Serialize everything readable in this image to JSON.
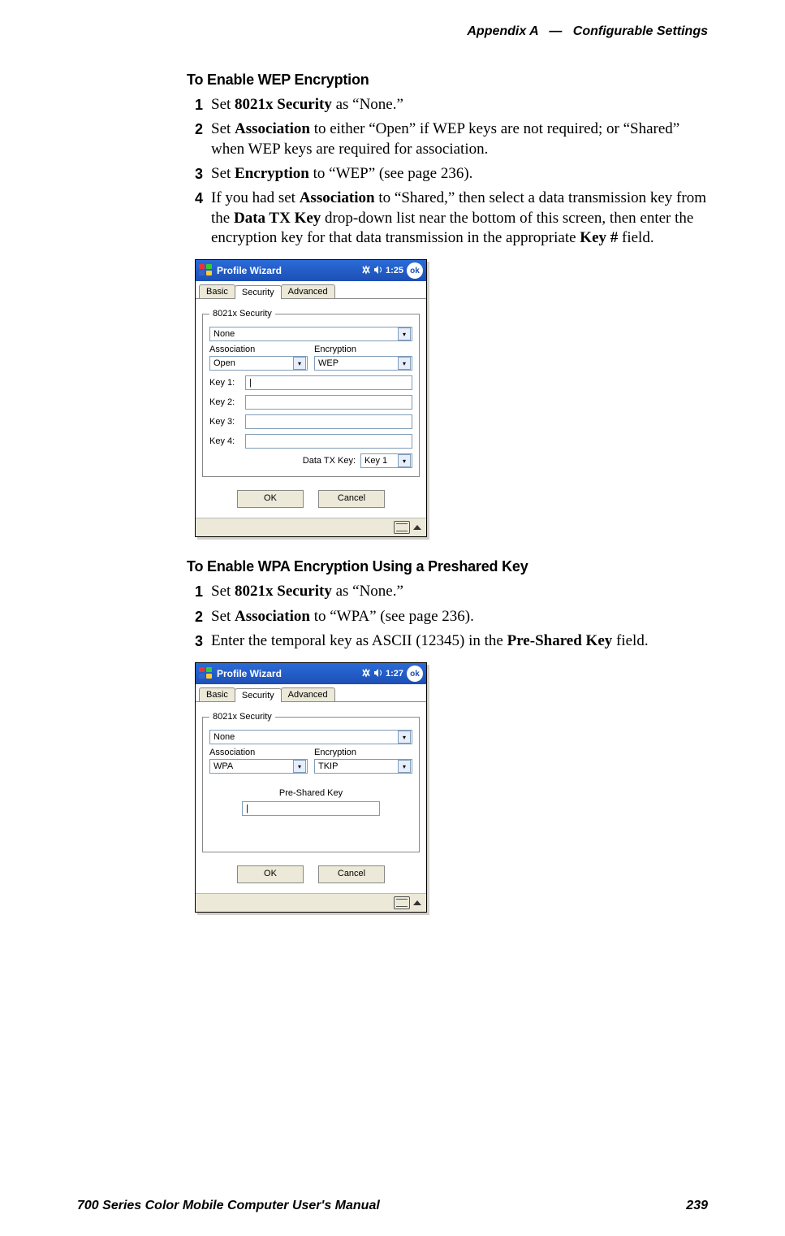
{
  "header": {
    "appendix": "Appendix A",
    "sep": "—",
    "title": "Configurable Settings"
  },
  "footer": {
    "left": "700 Series Color Mobile Computer User's Manual",
    "right": "239"
  },
  "wep": {
    "title": "To Enable WEP Encryption",
    "steps": {
      "s1": {
        "num": "1",
        "pre": "Set ",
        "b1": "8021x Security",
        "post": " as “None.”"
      },
      "s2": {
        "num": "2",
        "pre": "Set ",
        "b1": "Association",
        "post": " to either “Open” if WEP keys are not required; or “Shared” when WEP keys are required for association."
      },
      "s3": {
        "num": "3",
        "pre": "Set ",
        "b1": "Encryption",
        "post": " to “WEP” (see page 236)."
      },
      "s4": {
        "num": "4",
        "a": "If you had set ",
        "b1": "Association",
        "b": " to “Shared,” then select a data transmission key from the ",
        "b2": "Data TX Key",
        "c": " drop-down list near the bottom of this screen, then enter the encryption key for that data transmission in the appropriate ",
        "b3": "Key #",
        "d": " field."
      }
    }
  },
  "wpa": {
    "title": "To Enable WPA Encryption Using a Preshared Key",
    "steps": {
      "s1": {
        "num": "1",
        "pre": "Set ",
        "b1": "8021x Security",
        "post": " as “None.”"
      },
      "s2": {
        "num": "2",
        "pre": "Set ",
        "b1": "Association",
        "post": " to “WPA” (see page 236)."
      },
      "s3": {
        "num": "3",
        "a": "Enter the temporal key as ASCII (12345) in the ",
        "b1": "Pre-Shared Key",
        "b": " field."
      }
    }
  },
  "shot1": {
    "title": "Profile Wizard",
    "clock": "1:25",
    "ok": "ok",
    "tabs": {
      "basic": "Basic",
      "security": "Security",
      "advanced": "Advanced"
    },
    "group": "8021x Security",
    "securitySel": "None",
    "assocLabel": "Association",
    "encLabel": "Encryption",
    "assocSel": "Open",
    "encSel": "WEP",
    "key1": "Key 1:",
    "key2": "Key 2:",
    "key3": "Key 3:",
    "key4": "Key 4:",
    "dtxLabel": "Data TX Key:",
    "dtxSel": "Key 1",
    "okbtn": "OK",
    "cancel": "Cancel"
  },
  "shot2": {
    "title": "Profile Wizard",
    "clock": "1:27",
    "ok": "ok",
    "tabs": {
      "basic": "Basic",
      "security": "Security",
      "advanced": "Advanced"
    },
    "group": "8021x Security",
    "securitySel": "None",
    "assocLabel": "Association",
    "encLabel": "Encryption",
    "assocSel": "WPA",
    "encSel": "TKIP",
    "pskLabel": "Pre-Shared Key",
    "okbtn": "OK",
    "cancel": "Cancel"
  }
}
